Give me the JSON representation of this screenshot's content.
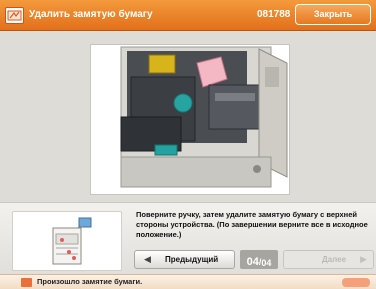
{
  "titlebar": {
    "title": "Удалить замятую бумагу",
    "job_code": "081788",
    "close_label": "Закрыть",
    "icon": "paper-jam-icon",
    "accent_color": "#e9781f"
  },
  "illustration": {
    "icon": "printer-open-door-illustration"
  },
  "instructions": {
    "message": "Поверните ручку, затем удалите замятую бумагу с верхней стороны устройства. (По завершении верните все в исходное положение.)"
  },
  "navigation": {
    "prev_label": "Предыдущий",
    "next_label": "Далее",
    "current_page": "04",
    "separator": "/",
    "total_pages": "04"
  },
  "status": {
    "text": "Произошло замятие бумаги.",
    "icon": "paper-jam-status-icon"
  }
}
